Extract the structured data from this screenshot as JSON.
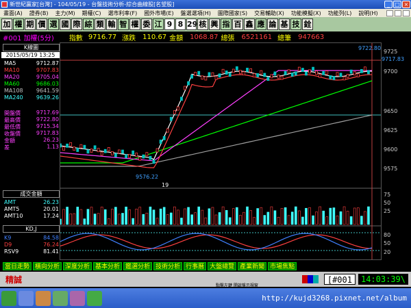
{
  "window": {
    "title": "新世紀贏家[台灣] - 104/05/19 - 台盤技術分析-綜合曲線股[名望股]"
  },
  "menu": [
    "畫面(A)",
    "證券(B)",
    "主力(M)",
    "期權(C)",
    "選市利率(F)",
    "國外市場(E)",
    "盤選選項(H)",
    "圖際國家(S)",
    "交易輔助(X)",
    "功能模擬(X)",
    "功能列(L)",
    "說明(H)"
  ],
  "toolbar": [
    "加",
    "權",
    "期",
    "價",
    "選",
    "國",
    "際",
    "綜",
    "類",
    "輸",
    "智",
    "權",
    "委",
    "江",
    "9",
    "8",
    "29",
    "核",
    "興",
    "指",
    "百",
    "鑫",
    "應",
    "論",
    "基",
    "技",
    "銓"
  ],
  "info": {
    "code": "#001 加權(5分)",
    "idx_label": "指數",
    "idx_value": "9716.77",
    "chg_label": "漲跌",
    "chg_value": "110.67",
    "amt_label": "金額",
    "amt_value": "1068.87",
    "vol_label": "總張",
    "vol_value": "6521161",
    "cnt_label": "總筆",
    "cnt_value": "947663"
  },
  "left": {
    "section_kline": "K線圖",
    "datetime": "2015/05/19 13:25",
    "ma": [
      {
        "label": "MA5",
        "value": "9712.87",
        "color": "#ffffff"
      },
      {
        "label": "MA10",
        "value": "9707.83",
        "color": "#ff4040"
      },
      {
        "label": "MA20",
        "value": "9705.04",
        "color": "#ff40ff"
      },
      {
        "label": "MA60",
        "value": "9686.03",
        "color": "#00ff00"
      },
      {
        "label": "MA108",
        "value": "9641.59",
        "color": "#c0c0c0"
      },
      {
        "label": "MA240",
        "value": "9639.26",
        "color": "#40ffff"
      }
    ],
    "prices": [
      {
        "label": "開盤價",
        "value": "9717.69",
        "color": "#ff40ff"
      },
      {
        "label": "最高價",
        "value": "9722.80",
        "color": "#ff40ff"
      },
      {
        "label": "最低價",
        "value": "9715.34",
        "color": "#ff40ff"
      },
      {
        "label": "收盤價",
        "value": "9717.83",
        "color": "#ff40ff"
      },
      {
        "label": "金額",
        "value": "26.23",
        "color": "#ff40ff"
      },
      {
        "label": "差",
        "value": "1.13",
        "color": "#ff40ff"
      }
    ],
    "section_amt": "成交金額",
    "amt": [
      {
        "label": "AMT",
        "value": "26.23",
        "color": "#40ffff"
      },
      {
        "label": "AMT5",
        "value": "20.01",
        "color": "#ffffff"
      },
      {
        "label": "AMT10",
        "value": "17.24",
        "color": "#ffffff"
      }
    ],
    "section_kd": "KD,J",
    "kd": [
      {
        "label": "K9",
        "value": "84.58",
        "color": "#4080ff"
      },
      {
        "label": "D9",
        "value": "76.24",
        "color": "#ff4040"
      },
      {
        "label": "RSV9",
        "value": "81.41",
        "color": "#ffffff"
      }
    ]
  },
  "chart": {
    "high_label": "9722.80",
    "low_label": "9576.22",
    "day_label": "19",
    "current_label": "9717.83",
    "price_ticks": [
      "9725",
      "9700",
      "9650",
      "9625",
      "9600",
      "9575"
    ],
    "amt_ticks": [
      "75",
      "50",
      "25"
    ],
    "kd_ticks": [
      "80",
      "50",
      "20"
    ]
  },
  "tabs": [
    "當日走勢",
    "橫向分析",
    "深度分析",
    "基本分析",
    "鑑選分析",
    "技術分析",
    "行事曆",
    "大盤總覽",
    "產業新聞",
    "市場焦點"
  ],
  "status": {
    "name": "精誠",
    "symbol": "[#001",
    "time": "14:03:39\\",
    "note": "點擊左鍵 開啟盤示視窗"
  },
  "taskbar": {
    "url": "http://kujd3268.pixnet.net/album"
  }
}
